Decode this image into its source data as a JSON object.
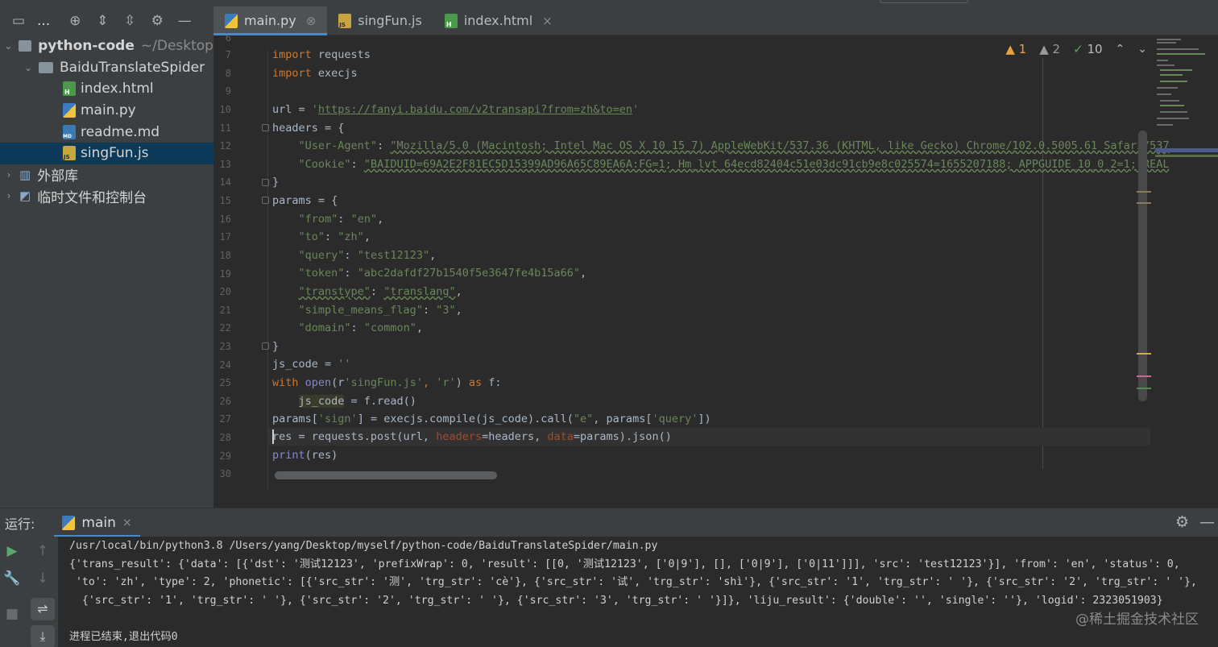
{
  "project_toolbar": {
    "label": "...",
    "icons": [
      "project-view-icon",
      "locate-icon",
      "expand-all-icon",
      "collapse-all-icon",
      "gear-icon",
      "hide-icon"
    ]
  },
  "tabs": [
    {
      "label": "main.py",
      "type": "py",
      "active": true
    },
    {
      "label": "singFun.js",
      "type": "js",
      "active": false
    },
    {
      "label": "index.html",
      "type": "html",
      "active": false
    }
  ],
  "project": {
    "root": {
      "label": "python-code",
      "path": "~/Desktop"
    },
    "folder": "BaiduTranslateSpider",
    "files": [
      "index.html",
      "main.py",
      "readme.md",
      "singFun.js"
    ],
    "selected_file": "singFun.js",
    "external_libs": "外部库",
    "scratches": "临时文件和控制台"
  },
  "editor": {
    "line_numbers": [
      "6",
      "7",
      "8",
      "9",
      "10",
      "11",
      "12",
      "13",
      "14",
      "15",
      "16",
      "17",
      "18",
      "19",
      "20",
      "21",
      "22",
      "23",
      "24",
      "25",
      "26",
      "27",
      "28",
      "29",
      "30"
    ],
    "inspections": {
      "warnings": "1",
      "weak_warnings": "2",
      "ok": "10"
    },
    "code": {
      "l7_kw": "import",
      "l7_rest": " requests",
      "l8_kw": "import",
      "l8_rest": " execjs",
      "l10_a": "url = ",
      "l10_q1": "'",
      "l10_url": "https://fanyi.baidu.com/v2transapi?from=zh&to=en",
      "l10_q2": "'",
      "l11": "headers = {",
      "l12_key": "\"User-Agent\"",
      "l12_sep": ": ",
      "l12_val": "\"Mozilla/5.0 (Macintosh; Intel Mac OS X 10_15_7) AppleWebKit/537.36 (KHTML, like Gecko) Chrome/102.0.5005.61 Safari/537",
      "l13_key": "\"Cookie\"",
      "l13_sep": ": ",
      "l13_val": "\"BAIDUID=69A2E2F81EC5D15399AD96A65C89EA6A:FG=1; Hm_lvt_64ecd82404c51e03dc91cb9e8c025574=1655207188; APPGUIDE_10_0_2=1; REAL",
      "l14": "}",
      "l15": "params = {",
      "l16_key": "\"from\"",
      "l16_val": "\"en\"",
      "l17_key": "\"to\"",
      "l17_val": "\"zh\"",
      "l18_key": "\"query\"",
      "l18_val": "\"test12123\"",
      "l19_key": "\"token\"",
      "l19_val": "\"abc2dafdf27b1540f5e3647fe4b15a66\"",
      "l20_key": "\"transtype\"",
      "l20_val": "\"translang\"",
      "l21_key": "\"simple_means_flag\"",
      "l21_val": "\"3\"",
      "l22_key": "\"domain\"",
      "l22_val": "\"common\"",
      "l23": "}",
      "l24_a": "js_code = ",
      "l24_s": "''",
      "l25_kw": "with",
      "l25_b": " open",
      "l25_c": "(r",
      "l25_s1": "'singFun.js'",
      "l25_d": ", ",
      "l25_s2": "'r'",
      "l25_e": ") ",
      "l25_as": "as",
      "l25_f": " f:",
      "l26_var": "js_code",
      "l26_rest": " = f.read()",
      "l27_a": "params[",
      "l27_s1": "'sign'",
      "l27_b": "] = execjs.compile(js_code).call(",
      "l27_s2": "\"e\"",
      "l27_c": ", params[",
      "l27_s3": "'query'",
      "l27_d": "])",
      "l28_a": "res = requests.post(url, ",
      "l28_p1": "headers",
      "l28_b": "=headers, ",
      "l28_p2": "data",
      "l28_c": "=params).json()",
      "l29_fn": "print",
      "l29_rest": "(res)"
    }
  },
  "run": {
    "label": "运行:",
    "tab": "main",
    "console": [
      "/usr/local/bin/python3.8 /Users/yang/Desktop/myself/python-code/BaiduTranslateSpider/main.py",
      "{'trans_result': {'data': [{'dst': '测试12123', 'prefixWrap': 0, 'result': [[0, '测试12123', ['0|9'], [], ['0|9'], ['0|11']]], 'src': 'test12123'}], 'from': 'en', 'status': 0,",
      " 'to': 'zh', 'type': 2, 'phonetic': [{'src_str': '测', 'trg_str': 'cè'}, {'src_str': '试', 'trg_str': 'shì'}, {'src_str': '1', 'trg_str': ' '}, {'src_str': '2', 'trg_str': ' '},",
      "  {'src_str': '1', 'trg_str': ' '}, {'src_str': '2', 'trg_str': ' '}, {'src_str': '3', 'trg_str': ' '}]}, 'liju_result': {'double': '', 'single': ''}, 'logid': 2323051903}",
      "",
      "进程已结束,退出代码0"
    ]
  },
  "watermark": "@稀土掘金技术社区",
  "colors": {
    "accent": "#4a88c7",
    "keyword": "#cc7832",
    "string": "#6a8759",
    "url": "#287bde",
    "selection": "#0d3a58"
  }
}
